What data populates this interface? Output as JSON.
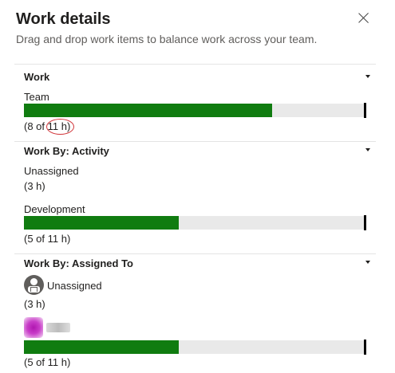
{
  "panel": {
    "title": "Work details",
    "subtitle": "Drag and drop work items to balance work across your team."
  },
  "sections": {
    "work": {
      "title": "Work",
      "rows": [
        {
          "label": "Team",
          "hours_text": "(8 of 11 h)",
          "progress": 0.73
        }
      ]
    },
    "by_activity": {
      "title": "Work By: Activity",
      "rows": [
        {
          "label": "Unassigned",
          "hours_text": "(3 h)"
        },
        {
          "label": "Development",
          "hours_text": "(5 of 11 h)",
          "progress": 0.456
        }
      ]
    },
    "by_assigned": {
      "title": "Work By: Assigned To",
      "rows": [
        {
          "label": "Unassigned",
          "hours_text": "(3 h)",
          "icon": "person-icon"
        },
        {
          "label": "",
          "hours_text": "(5 of 11 h)",
          "progress": 0.456,
          "icon": "blurred-avatar"
        }
      ]
    }
  },
  "colors": {
    "progress_fill": "#107c10",
    "progress_track": "#e9e9e9",
    "highlight_circle": "#d13438"
  }
}
